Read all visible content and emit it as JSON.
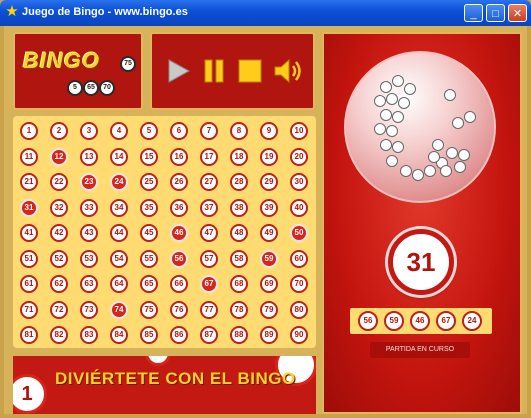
{
  "window": {
    "title": "Juego de Bingo - www.bingo.es",
    "app_icon": "star-icon",
    "buttons": {
      "minimize": "_",
      "maximize": "□",
      "close": "✕"
    }
  },
  "logo": {
    "text": "BINGO",
    "balls": [
      "75",
      "5",
      "70",
      "65"
    ]
  },
  "controls": {
    "play": "play-icon",
    "pause": "pause-icon",
    "stop": "stop-icon",
    "sound": "speaker-icon"
  },
  "board": {
    "numbers": [
      1,
      2,
      3,
      4,
      5,
      6,
      7,
      8,
      9,
      10,
      11,
      12,
      13,
      14,
      15,
      16,
      17,
      18,
      19,
      20,
      21,
      22,
      23,
      24,
      25,
      26,
      27,
      28,
      29,
      30,
      31,
      32,
      33,
      34,
      35,
      36,
      37,
      38,
      39,
      40,
      41,
      42,
      43,
      44,
      45,
      46,
      47,
      48,
      49,
      50,
      51,
      52,
      53,
      54,
      55,
      56,
      57,
      58,
      59,
      60,
      61,
      62,
      63,
      64,
      65,
      66,
      67,
      68,
      69,
      70,
      71,
      72,
      73,
      74,
      75,
      76,
      77,
      78,
      79,
      80,
      81,
      82,
      83,
      84,
      85,
      86,
      87,
      88,
      89,
      90
    ],
    "called": [
      12,
      23,
      24,
      31,
      46,
      50,
      56,
      59,
      67,
      74
    ]
  },
  "banner": {
    "text": "DIVIÉRTETE CON EL BINGO",
    "deco_ball": "1"
  },
  "draw": {
    "current": "31",
    "recent": [
      "56",
      "59",
      "46",
      "67",
      "24"
    ],
    "status": "PARTIDA EN CURSO"
  },
  "colors": {
    "accent_red": "#c21a12",
    "gold": "#ffdb72",
    "called_red": "#d9241c"
  }
}
